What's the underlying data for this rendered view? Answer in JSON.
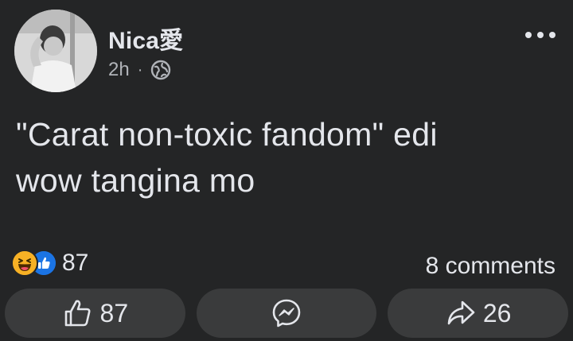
{
  "post": {
    "author": "Nica愛",
    "time": "2h",
    "separator": "·",
    "audience_icon": "globe-icon",
    "more_icon": "more-horizontal-icon",
    "text": "\"Carat non-toxic fandom\" edi\nwow tangina mo"
  },
  "reactions": {
    "icons": [
      "haha-reaction-icon",
      "like-reaction-icon"
    ],
    "count": "87",
    "comments_label": "8 comments"
  },
  "actions": {
    "like_count": "87",
    "share_count": "26",
    "icons": [
      "thumbs-up-icon",
      "messenger-icon",
      "share-arrow-icon"
    ]
  },
  "colors": {
    "background": "#242526",
    "button": "#3a3b3c",
    "text_primary": "#e4e6eb",
    "text_secondary": "#b0b3b8",
    "like_blue": "#1b74e4",
    "haha_yellow": "#f7b125"
  }
}
